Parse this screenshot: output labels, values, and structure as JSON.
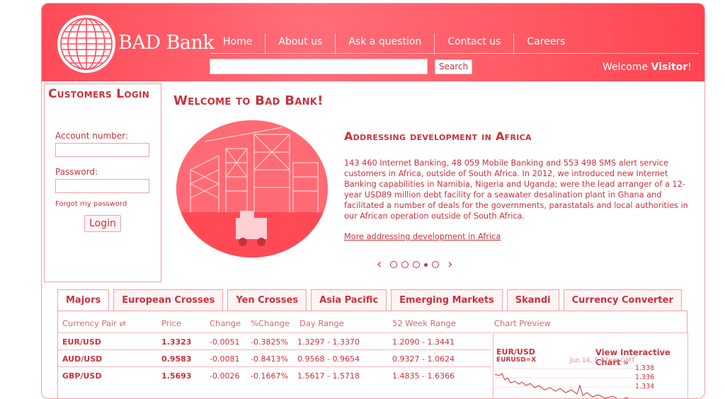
{
  "brand": {
    "name": "BAD Bank"
  },
  "nav": {
    "items": [
      "Home",
      "About us",
      "Ask a question",
      "Contact us",
      "Careers"
    ]
  },
  "search": {
    "value": "",
    "placeholder": "",
    "button": "Search"
  },
  "welcome": {
    "prefix": "Welcome ",
    "user": "Visitor",
    "suffix": "!"
  },
  "login": {
    "title": "Customers Login",
    "account_label": "Account number:",
    "password_label": "Password:",
    "forgot": "Forgot my password",
    "button": "Login"
  },
  "main": {
    "title": "Welcome to Bad Bank!",
    "article_title": "Addressing development in Africa",
    "article_text": "143 460 Internet Banking, 48 059 Mobile Banking and 553 498 SMS alert service customers in Africa, outside of South Africa. In 2012, we introduced new Internet Banking capabilities in Namibia, Nigeria and Uganda; were the lead arranger of a 12-year USD89 million debt facility for a seawater desalination plant in Ghana and facilitated a number of deals for the governments, parastatals and local authorities in our African operation outside of South Africa.",
    "article_link": "More addressing development in Africa",
    "prev": "‹",
    "next": "›"
  },
  "market": {
    "tabs": [
      "Majors",
      "European Crosses",
      "Yen Crosses",
      "Asia Pacific",
      "Emerging Markets",
      "Skandi",
      "Currency Converter"
    ],
    "active_tab": 0,
    "columns": [
      "Currency Pair",
      "Price",
      "Change",
      "%Change",
      "Day Range",
      "52 Week Range",
      "Chart Preview"
    ],
    "rows": [
      {
        "pair": "EUR/USD",
        "price": "1.3323",
        "change": "-0.0051",
        "pct": "-0.3825%",
        "day": "1.3297 - 1.3370",
        "week": "1.2090 - 1.3441"
      },
      {
        "pair": "AUD/USD",
        "price": "0.9583",
        "change": "-0.0081",
        "pct": "-0.8413%",
        "day": "0.9568 - 0.9654",
        "week": "0.9327 - 1.0624"
      },
      {
        "pair": "GBP/USD",
        "price": "1.5693",
        "change": "-0.0026",
        "pct": "-0.1667%",
        "day": "1.5617 - 1.5718",
        "week": "1.4835 - 1.6366"
      }
    ],
    "chart": {
      "pair": "EUR/USD",
      "symbol": "EURUSD=X",
      "link": "View Interactive Chart »",
      "date": "Jun 14, 5:27pm GMT",
      "yticks": [
        "1.338",
        "1.336",
        "1.334"
      ]
    }
  }
}
